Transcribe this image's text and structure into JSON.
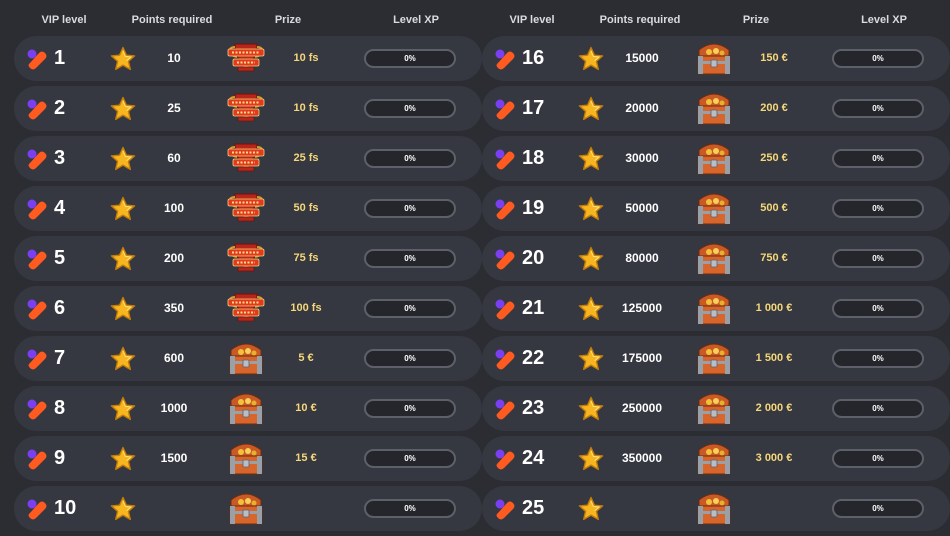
{
  "headers": {
    "vip_level": "VIP level",
    "points_required": "Points required",
    "prize": "Prize",
    "level_xp": "Level XP"
  },
  "left_rows": [
    {
      "level": "1",
      "points": "10",
      "prize": "10 fs",
      "prize_type": "free-spins",
      "xp": "0%"
    },
    {
      "level": "2",
      "points": "25",
      "prize": "10 fs",
      "prize_type": "free-spins",
      "xp": "0%"
    },
    {
      "level": "3",
      "points": "60",
      "prize": "25 fs",
      "prize_type": "free-spins",
      "xp": "0%"
    },
    {
      "level": "4",
      "points": "100",
      "prize": "50 fs",
      "prize_type": "free-spins",
      "xp": "0%"
    },
    {
      "level": "5",
      "points": "200",
      "prize": "75 fs",
      "prize_type": "free-spins",
      "xp": "0%"
    },
    {
      "level": "6",
      "points": "350",
      "prize": "100 fs",
      "prize_type": "free-spins",
      "xp": "0%"
    },
    {
      "level": "7",
      "points": "600",
      "prize": "5 €",
      "prize_type": "treasure-chest",
      "xp": "0%"
    },
    {
      "level": "8",
      "points": "1000",
      "prize": "10 €",
      "prize_type": "treasure-chest",
      "xp": "0%"
    },
    {
      "level": "9",
      "points": "1500",
      "prize": "15 €",
      "prize_type": "treasure-chest",
      "xp": "0%"
    },
    {
      "level": "10",
      "points": "",
      "prize": "",
      "prize_type": "treasure-chest",
      "xp": "0%"
    }
  ],
  "right_rows": [
    {
      "level": "16",
      "points": "15000",
      "prize": "150 €",
      "prize_type": "treasure-chest",
      "xp": "0%"
    },
    {
      "level": "17",
      "points": "20000",
      "prize": "200 €",
      "prize_type": "treasure-chest",
      "xp": "0%"
    },
    {
      "level": "18",
      "points": "30000",
      "prize": "250 €",
      "prize_type": "treasure-chest",
      "xp": "0%"
    },
    {
      "level": "19",
      "points": "50000",
      "prize": "500 €",
      "prize_type": "treasure-chest",
      "xp": "0%"
    },
    {
      "level": "20",
      "points": "80000",
      "prize": "750 €",
      "prize_type": "treasure-chest",
      "xp": "0%"
    },
    {
      "level": "21",
      "points": "125000",
      "prize": "1 000 €",
      "prize_type": "treasure-chest",
      "xp": "0%"
    },
    {
      "level": "22",
      "points": "175000",
      "prize": "1 500 €",
      "prize_type": "treasure-chest",
      "xp": "0%"
    },
    {
      "level": "23",
      "points": "250000",
      "prize": "2 000 €",
      "prize_type": "treasure-chest",
      "xp": "0%"
    },
    {
      "level": "24",
      "points": "350000",
      "prize": "3 000 €",
      "prize_type": "treasure-chest",
      "xp": "0%"
    },
    {
      "level": "25",
      "points": "",
      "prize": "",
      "prize_type": "treasure-chest",
      "xp": "0%"
    }
  ],
  "icons": {
    "vip": "vip-badge-icon",
    "points": "star-icon",
    "free_spins": "free-spins-trophy-icon",
    "chest": "treasure-chest-icon"
  },
  "colors": {
    "background": "#2b2d33",
    "row": "#353840",
    "prize_text": "#f5d77a",
    "vip_purple": "#7a3ff0",
    "vip_orange": "#ff5a1f",
    "star": "#f7b51f"
  }
}
